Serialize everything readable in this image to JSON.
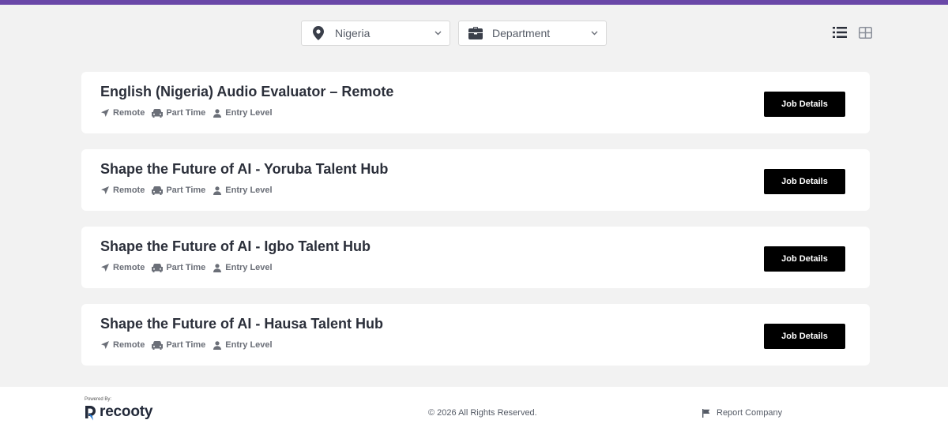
{
  "colors": {
    "accent_bar": "#6a48a8",
    "button_bg": "#000000",
    "page_bg": "#f2f2f2"
  },
  "filters": {
    "location": {
      "icon": "map-pin-icon",
      "value": "Nigeria"
    },
    "department": {
      "icon": "briefcase-icon",
      "value": "Department"
    }
  },
  "view_toggles": [
    {
      "icon": "list-view-icon",
      "active": true
    },
    {
      "icon": "grid-view-icon",
      "active": false
    }
  ],
  "jobs": [
    {
      "title": "English (Nigeria) Audio Evaluator – Remote",
      "location": "Remote",
      "type": "Part Time",
      "level": "Entry Level",
      "button": "Job Details"
    },
    {
      "title": "Shape the Future of AI - Yoruba Talent Hub",
      "location": "Remote",
      "type": "Part Time",
      "level": "Entry Level",
      "button": "Job Details"
    },
    {
      "title": "Shape the Future of AI - Igbo Talent Hub",
      "location": "Remote",
      "type": "Part Time",
      "level": "Entry Level",
      "button": "Job Details"
    },
    {
      "title": "Shape the Future of AI - Hausa Talent Hub",
      "location": "Remote",
      "type": "Part Time",
      "level": "Entry Level",
      "button": "Job Details"
    }
  ],
  "footer": {
    "powered_by": "Powered By:",
    "brand": "recooty",
    "copyright": "© 2026 All Rights Reserved.",
    "report": "Report Company",
    "report_icon": "flag-icon"
  }
}
